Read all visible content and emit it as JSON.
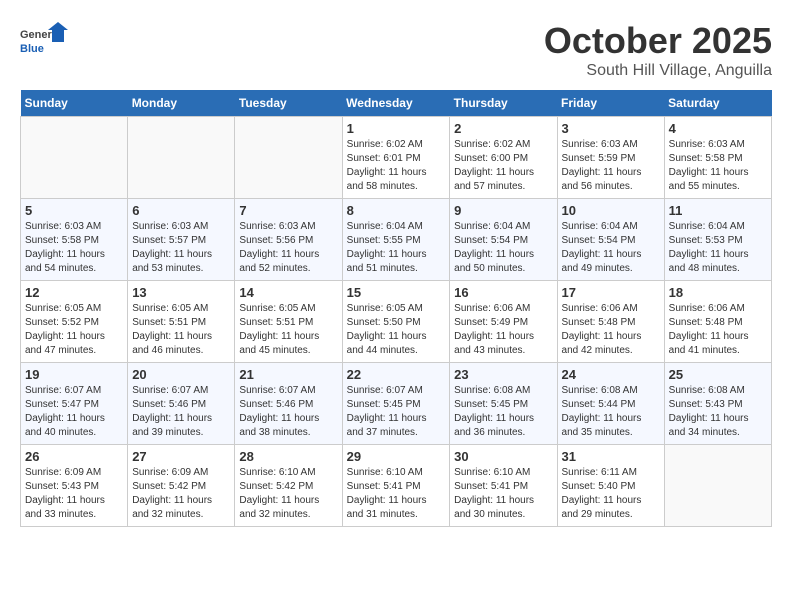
{
  "header": {
    "logo_general": "General",
    "logo_blue": "Blue",
    "month": "October 2025",
    "location": "South Hill Village, Anguilla"
  },
  "days_of_week": [
    "Sunday",
    "Monday",
    "Tuesday",
    "Wednesday",
    "Thursday",
    "Friday",
    "Saturday"
  ],
  "weeks": [
    [
      {
        "day": "",
        "sunrise": "",
        "sunset": "",
        "daylight": ""
      },
      {
        "day": "",
        "sunrise": "",
        "sunset": "",
        "daylight": ""
      },
      {
        "day": "",
        "sunrise": "",
        "sunset": "",
        "daylight": ""
      },
      {
        "day": "1",
        "sunrise": "Sunrise: 6:02 AM",
        "sunset": "Sunset: 6:01 PM",
        "daylight": "Daylight: 11 hours and 58 minutes."
      },
      {
        "day": "2",
        "sunrise": "Sunrise: 6:02 AM",
        "sunset": "Sunset: 6:00 PM",
        "daylight": "Daylight: 11 hours and 57 minutes."
      },
      {
        "day": "3",
        "sunrise": "Sunrise: 6:03 AM",
        "sunset": "Sunset: 5:59 PM",
        "daylight": "Daylight: 11 hours and 56 minutes."
      },
      {
        "day": "4",
        "sunrise": "Sunrise: 6:03 AM",
        "sunset": "Sunset: 5:58 PM",
        "daylight": "Daylight: 11 hours and 55 minutes."
      }
    ],
    [
      {
        "day": "5",
        "sunrise": "Sunrise: 6:03 AM",
        "sunset": "Sunset: 5:58 PM",
        "daylight": "Daylight: 11 hours and 54 minutes."
      },
      {
        "day": "6",
        "sunrise": "Sunrise: 6:03 AM",
        "sunset": "Sunset: 5:57 PM",
        "daylight": "Daylight: 11 hours and 53 minutes."
      },
      {
        "day": "7",
        "sunrise": "Sunrise: 6:03 AM",
        "sunset": "Sunset: 5:56 PM",
        "daylight": "Daylight: 11 hours and 52 minutes."
      },
      {
        "day": "8",
        "sunrise": "Sunrise: 6:04 AM",
        "sunset": "Sunset: 5:55 PM",
        "daylight": "Daylight: 11 hours and 51 minutes."
      },
      {
        "day": "9",
        "sunrise": "Sunrise: 6:04 AM",
        "sunset": "Sunset: 5:54 PM",
        "daylight": "Daylight: 11 hours and 50 minutes."
      },
      {
        "day": "10",
        "sunrise": "Sunrise: 6:04 AM",
        "sunset": "Sunset: 5:54 PM",
        "daylight": "Daylight: 11 hours and 49 minutes."
      },
      {
        "day": "11",
        "sunrise": "Sunrise: 6:04 AM",
        "sunset": "Sunset: 5:53 PM",
        "daylight": "Daylight: 11 hours and 48 minutes."
      }
    ],
    [
      {
        "day": "12",
        "sunrise": "Sunrise: 6:05 AM",
        "sunset": "Sunset: 5:52 PM",
        "daylight": "Daylight: 11 hours and 47 minutes."
      },
      {
        "day": "13",
        "sunrise": "Sunrise: 6:05 AM",
        "sunset": "Sunset: 5:51 PM",
        "daylight": "Daylight: 11 hours and 46 minutes."
      },
      {
        "day": "14",
        "sunrise": "Sunrise: 6:05 AM",
        "sunset": "Sunset: 5:51 PM",
        "daylight": "Daylight: 11 hours and 45 minutes."
      },
      {
        "day": "15",
        "sunrise": "Sunrise: 6:05 AM",
        "sunset": "Sunset: 5:50 PM",
        "daylight": "Daylight: 11 hours and 44 minutes."
      },
      {
        "day": "16",
        "sunrise": "Sunrise: 6:06 AM",
        "sunset": "Sunset: 5:49 PM",
        "daylight": "Daylight: 11 hours and 43 minutes."
      },
      {
        "day": "17",
        "sunrise": "Sunrise: 6:06 AM",
        "sunset": "Sunset: 5:48 PM",
        "daylight": "Daylight: 11 hours and 42 minutes."
      },
      {
        "day": "18",
        "sunrise": "Sunrise: 6:06 AM",
        "sunset": "Sunset: 5:48 PM",
        "daylight": "Daylight: 11 hours and 41 minutes."
      }
    ],
    [
      {
        "day": "19",
        "sunrise": "Sunrise: 6:07 AM",
        "sunset": "Sunset: 5:47 PM",
        "daylight": "Daylight: 11 hours and 40 minutes."
      },
      {
        "day": "20",
        "sunrise": "Sunrise: 6:07 AM",
        "sunset": "Sunset: 5:46 PM",
        "daylight": "Daylight: 11 hours and 39 minutes."
      },
      {
        "day": "21",
        "sunrise": "Sunrise: 6:07 AM",
        "sunset": "Sunset: 5:46 PM",
        "daylight": "Daylight: 11 hours and 38 minutes."
      },
      {
        "day": "22",
        "sunrise": "Sunrise: 6:07 AM",
        "sunset": "Sunset: 5:45 PM",
        "daylight": "Daylight: 11 hours and 37 minutes."
      },
      {
        "day": "23",
        "sunrise": "Sunrise: 6:08 AM",
        "sunset": "Sunset: 5:45 PM",
        "daylight": "Daylight: 11 hours and 36 minutes."
      },
      {
        "day": "24",
        "sunrise": "Sunrise: 6:08 AM",
        "sunset": "Sunset: 5:44 PM",
        "daylight": "Daylight: 11 hours and 35 minutes."
      },
      {
        "day": "25",
        "sunrise": "Sunrise: 6:08 AM",
        "sunset": "Sunset: 5:43 PM",
        "daylight": "Daylight: 11 hours and 34 minutes."
      }
    ],
    [
      {
        "day": "26",
        "sunrise": "Sunrise: 6:09 AM",
        "sunset": "Sunset: 5:43 PM",
        "daylight": "Daylight: 11 hours and 33 minutes."
      },
      {
        "day": "27",
        "sunrise": "Sunrise: 6:09 AM",
        "sunset": "Sunset: 5:42 PM",
        "daylight": "Daylight: 11 hours and 32 minutes."
      },
      {
        "day": "28",
        "sunrise": "Sunrise: 6:10 AM",
        "sunset": "Sunset: 5:42 PM",
        "daylight": "Daylight: 11 hours and 32 minutes."
      },
      {
        "day": "29",
        "sunrise": "Sunrise: 6:10 AM",
        "sunset": "Sunset: 5:41 PM",
        "daylight": "Daylight: 11 hours and 31 minutes."
      },
      {
        "day": "30",
        "sunrise": "Sunrise: 6:10 AM",
        "sunset": "Sunset: 5:41 PM",
        "daylight": "Daylight: 11 hours and 30 minutes."
      },
      {
        "day": "31",
        "sunrise": "Sunrise: 6:11 AM",
        "sunset": "Sunset: 5:40 PM",
        "daylight": "Daylight: 11 hours and 29 minutes."
      },
      {
        "day": "",
        "sunrise": "",
        "sunset": "",
        "daylight": ""
      }
    ]
  ]
}
